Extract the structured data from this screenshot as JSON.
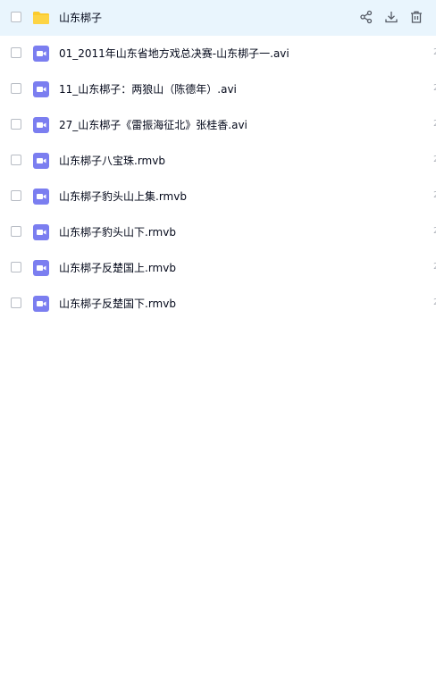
{
  "files": [
    {
      "name": "山东梆子",
      "type": "folder",
      "selected": true
    },
    {
      "name": "01_2011年山东省地方戏总决赛-山东梆子一.avi",
      "type": "video"
    },
    {
      "name": "11_山东梆子：两狼山（陈德年）.avi",
      "type": "video"
    },
    {
      "name": "27_山东梆子《雷振海征北》张桂香.avi",
      "type": "video"
    },
    {
      "name": "山东梆子八宝珠.rmvb",
      "type": "video"
    },
    {
      "name": "山东梆子豹头山上集.rmvb",
      "type": "video"
    },
    {
      "name": "山东梆子豹头山下.rmvb",
      "type": "video"
    },
    {
      "name": "山东梆子反楚国上.rmvb",
      "type": "video"
    },
    {
      "name": "山东梆子反楚国下.rmvb",
      "type": "video"
    }
  ],
  "actions": [
    {
      "icon": "share-icon",
      "name": "share-button"
    },
    {
      "icon": "download-icon",
      "name": "download-button"
    },
    {
      "icon": "delete-icon",
      "name": "delete-button"
    }
  ],
  "colors": {
    "selected_row_bg": "#e9f5fd",
    "folder": "#fbcb2e",
    "video": "#7b7ef0",
    "text": "#03081a"
  }
}
